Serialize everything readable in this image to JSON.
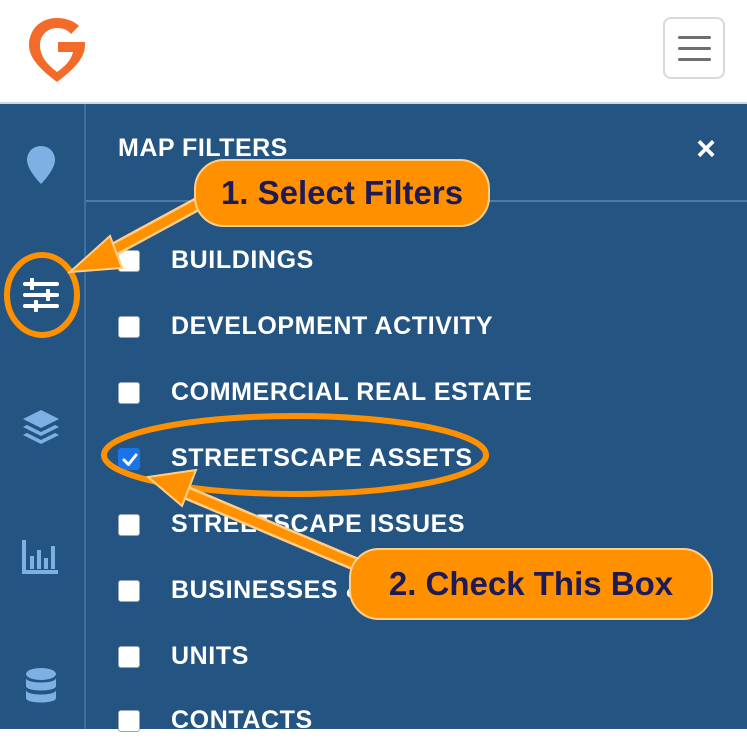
{
  "brand": {
    "logo_icon": "g-map-pin-logo",
    "accent": "#f26b2b"
  },
  "header": {
    "menu_icon": "hamburger-menu-icon"
  },
  "rail": {
    "items": [
      {
        "icon": "map-pin-icon"
      },
      {
        "icon": "filter-sliders-icon",
        "active": true
      },
      {
        "icon": "layers-icon"
      },
      {
        "icon": "bar-chart-icon"
      },
      {
        "icon": "database-icon"
      }
    ]
  },
  "panel": {
    "title": "MAP FILTERS",
    "close_icon": "×",
    "filters": [
      {
        "label": "BUILDINGS",
        "checked": false
      },
      {
        "label": "DEVELOPMENT ACTIVITY",
        "checked": false
      },
      {
        "label": "COMMERCIAL REAL ESTATE",
        "checked": false
      },
      {
        "label": "STREETSCAPE ASSETS",
        "checked": true
      },
      {
        "label": "STREETSCAPE ISSUES",
        "checked": false
      },
      {
        "label": "BUSINESSES &",
        "checked": false
      },
      {
        "label": "UNITS",
        "checked": false
      },
      {
        "label": "CONTACTS",
        "checked": false
      }
    ]
  },
  "annotations": {
    "step1": "1. Select Filters",
    "step2": "2. Check This Box",
    "callout_color": "#ff9100",
    "text_color": "#1e1a55"
  },
  "colors": {
    "panel_bg": "#245482",
    "icon_color": "#7fb0e3",
    "checkbox_checked": "#1a73e8"
  }
}
